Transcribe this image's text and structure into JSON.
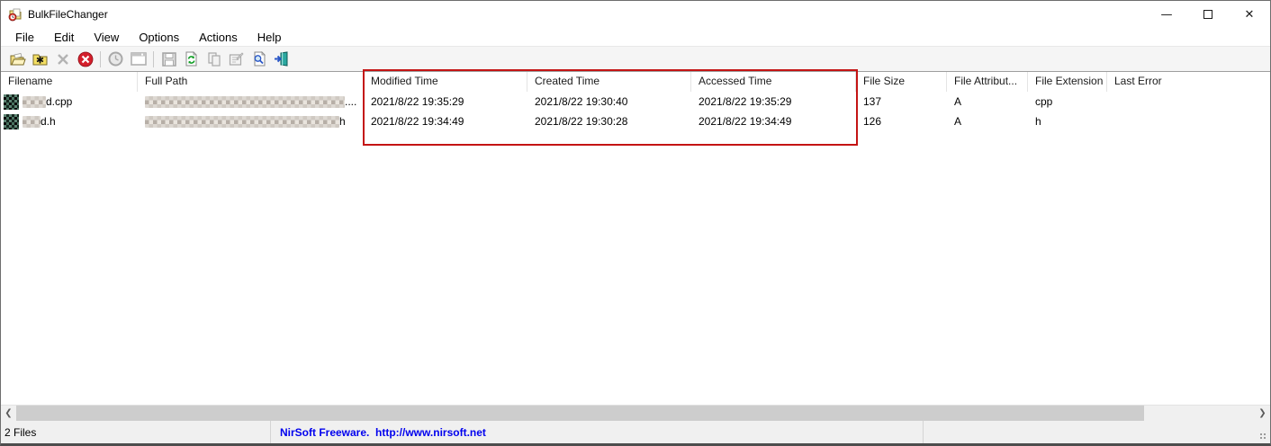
{
  "window": {
    "title": "BulkFileChanger",
    "controls": {
      "minimize": "—",
      "close": "✕"
    }
  },
  "menu": {
    "items": [
      "File",
      "Edit",
      "View",
      "Options",
      "Actions",
      "Help"
    ]
  },
  "toolbar": {
    "icons": [
      "open-files",
      "add-folder",
      "remove-file",
      "clear-list",
      "change-time",
      "execute-window",
      "save",
      "refresh",
      "copy",
      "file-properties",
      "find",
      "exit"
    ]
  },
  "table": {
    "columns": [
      "Filename",
      "Full Path",
      "Modified Time",
      "Created Time",
      "Accessed Time",
      "File Size",
      "File Attribut...",
      "File Extension",
      "Last Error"
    ],
    "rows": [
      {
        "filename_suffix": "d.cpp",
        "path_suffix": "....",
        "modified": "2021/8/22 19:35:29",
        "created": "2021/8/22 19:30:40",
        "accessed": "2021/8/22 19:35:29",
        "size": "137",
        "attributes": "A",
        "extension": "cpp",
        "last_error": ""
      },
      {
        "filename_suffix": "d.h",
        "path_suffix": "h",
        "modified": "2021/8/22 19:34:49",
        "created": "2021/8/22 19:30:28",
        "accessed": "2021/8/22 19:34:49",
        "size": "126",
        "attributes": "A",
        "extension": "h",
        "last_error": ""
      }
    ]
  },
  "scrollbar": {
    "left_arrow": "❮",
    "right_arrow": "❯"
  },
  "status": {
    "files_count": "2 Files",
    "freeware_text": "NirSoft Freeware.  http://www.nirsoft.net"
  },
  "colors": {
    "highlight_red": "#c41414",
    "link_blue": "#0000ee"
  }
}
